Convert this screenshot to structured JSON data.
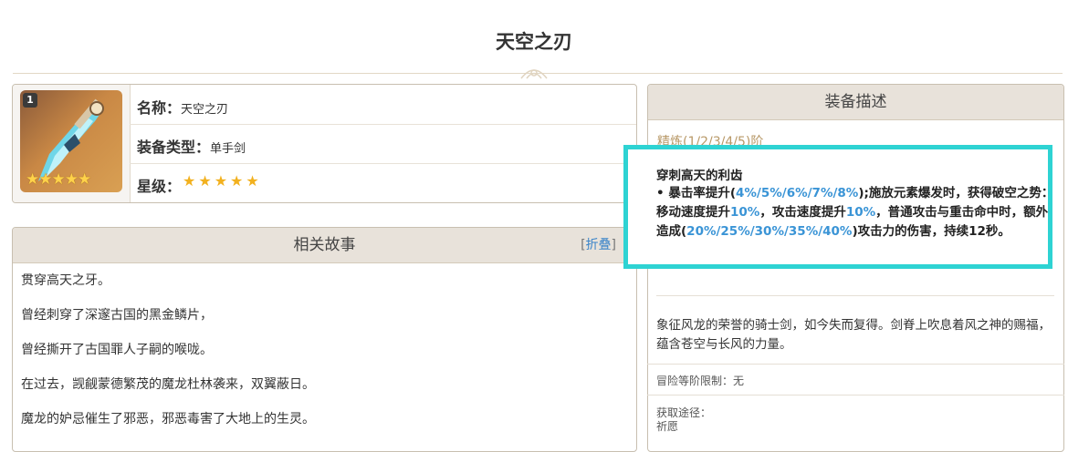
{
  "page": {
    "title": "天空之刃"
  },
  "weapon": {
    "level": "1",
    "image_icon": "sword-icon",
    "thumb_stars": "★★★★★",
    "rows": {
      "name_key": "名称：",
      "name_val": "天空之刃",
      "type_key": "装备类型：",
      "type_val": "单手剑",
      "rarity_key": "星级：",
      "rarity_stars": "★★★★★"
    }
  },
  "story": {
    "header": "相关故事",
    "fold_open": "[",
    "fold_label": "折叠",
    "fold_close": "]",
    "lines": [
      "贯穿高天之牙。",
      "曾经刺穿了深邃古国的黑金鳞片，",
      "曾经撕开了古国罪人子嗣的喉咙。",
      "在过去，觊觎蒙德繁茂的魔龙杜林袭来，双翼蔽日。",
      "魔龙的妒忌催生了邪恶，邪恶毒害了大地上的生灵。"
    ]
  },
  "description": {
    "header": "装备描述",
    "refine": "精炼(1/2/3/4/5)阶",
    "passive_title": "穿刺高天的利齿",
    "passive_parts": {
      "p1": "• 暴击率提升(",
      "h1": "4%/5%/6%/7%/8%",
      "p2": ");施放元素爆发时，获得破空之势：移动速度提升",
      "h2": "10%",
      "p3": "，攻击速度提升",
      "h3": "10%",
      "p4": "，普通攻击与重击命中时，额外造成(",
      "h4": "20%/25%/30%/35%/40%",
      "p5": ")攻击力的伤害，持续12秒。"
    },
    "lore": "象征风龙的荣誉的骑士剑，如今失而复得。剑脊上吹息着风之神的赐福，蕴含苍空与长风的力量。",
    "level_limit": "冒险等阶限制：无",
    "source_label": "获取途径：",
    "source_value": "祈愿"
  },
  "colors": {
    "highlight_border": "#2ed3d3",
    "value_blue": "#3a94d6",
    "refine_gold": "#b89968",
    "star_gold": "#f2b11f"
  }
}
